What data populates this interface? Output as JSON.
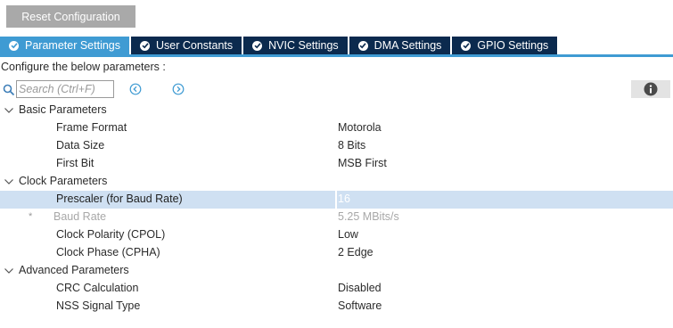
{
  "toolbar": {
    "reset_label": "Reset Configuration"
  },
  "tabs": [
    {
      "label": "Parameter Settings",
      "active": true
    },
    {
      "label": "User Constants",
      "active": false
    },
    {
      "label": "NVIC Settings",
      "active": false
    },
    {
      "label": "DMA Settings",
      "active": false
    },
    {
      "label": "GPIO Settings",
      "active": false
    }
  ],
  "config_label": "Configure the below parameters :",
  "search": {
    "placeholder": "Search (Ctrl+F)"
  },
  "groups": [
    {
      "label": "Basic Parameters",
      "params": [
        {
          "name": "Frame Format",
          "value": "Motorola"
        },
        {
          "name": "Data Size",
          "value": "8 Bits"
        },
        {
          "name": "First Bit",
          "value": "MSB First"
        }
      ]
    },
    {
      "label": "Clock Parameters",
      "params": [
        {
          "name": "Prescaler (for Baud Rate)",
          "value": "16"
        },
        {
          "name": "Baud Rate",
          "value": "5.25 MBits/s",
          "marker": "*"
        },
        {
          "name": "Clock Polarity (CPOL)",
          "value": "Low"
        },
        {
          "name": "Clock Phase (CPHA)",
          "value": "2 Edge"
        }
      ]
    },
    {
      "label": "Advanced Parameters",
      "params": [
        {
          "name": "CRC Calculation",
          "value": "Disabled"
        },
        {
          "name": "NSS Signal Type",
          "value": "Software"
        }
      ]
    }
  ],
  "colors": {
    "tab_active": "#3f9bd3",
    "tab_inactive": "#0b2a4e",
    "selected_row": "#cfe0f2",
    "reset_button": "#a9a9a9"
  },
  "icons": {
    "tab_status": "check-circle-icon",
    "search": "search-icon",
    "prev": "chevron-left-circle-icon",
    "next": "chevron-right-circle-icon",
    "info": "info-icon",
    "group_toggle": "chevron-down-icon"
  }
}
